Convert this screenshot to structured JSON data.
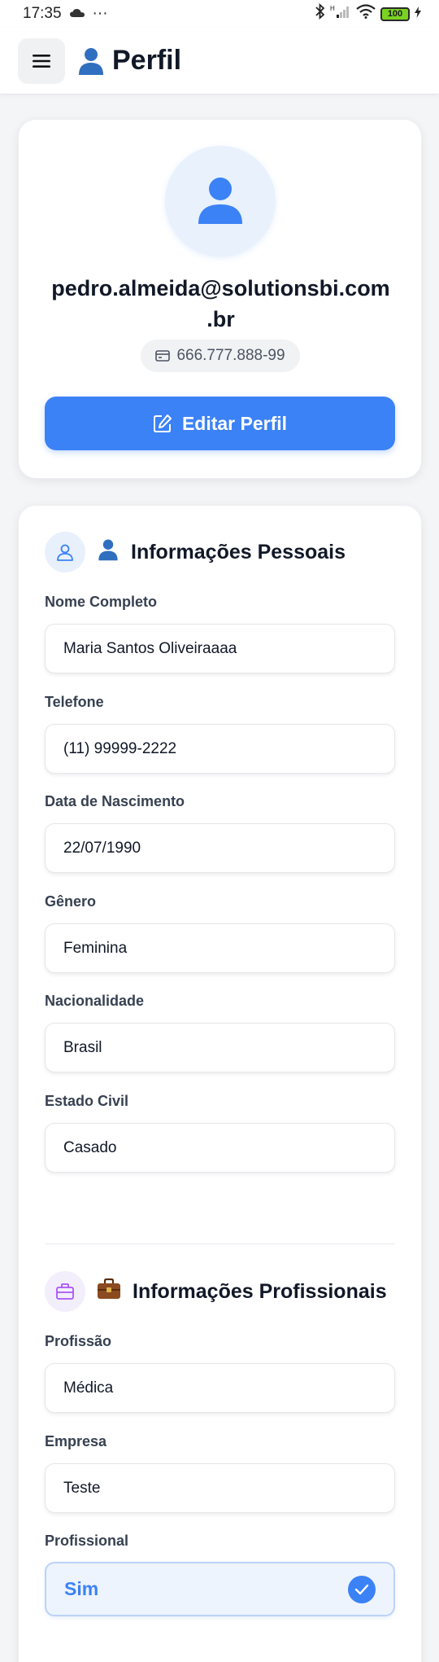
{
  "status_bar": {
    "time": "17:35",
    "more": "···",
    "battery": "100"
  },
  "header": {
    "title": "Perfil",
    "title_icon": "person-emoji",
    "menu_icon": "hamburger-icon"
  },
  "profile": {
    "email_line1": "pedro.almeida@solutionsbi.com",
    "email_line2": ".br",
    "cpf": "666.777.888-99",
    "edit_button_label": "Editar Perfil"
  },
  "personal": {
    "section_title": "Informações Pessoais",
    "fields": [
      {
        "label": "Nome Completo",
        "value": "Maria Santos Oliveiraaaa"
      },
      {
        "label": "Telefone",
        "value": "(11) 99999-2222"
      },
      {
        "label": "Data de Nascimento",
        "value": "22/07/1990"
      },
      {
        "label": "Gênero",
        "value": "Feminina"
      },
      {
        "label": "Nacionalidade",
        "value": "Brasil"
      },
      {
        "label": "Estado Civil",
        "value": "Casado"
      }
    ]
  },
  "professional": {
    "section_title": "Informações Profissionais",
    "fields": [
      {
        "label": "Profissão",
        "value": "Médica"
      },
      {
        "label": "Empresa",
        "value": "Teste"
      }
    ],
    "professional_label": "Profissional",
    "professional_value": "Sim"
  },
  "colors": {
    "accent": "#3b82f6",
    "background": "#f4f5f7",
    "accent_light": "#eef4fe"
  }
}
